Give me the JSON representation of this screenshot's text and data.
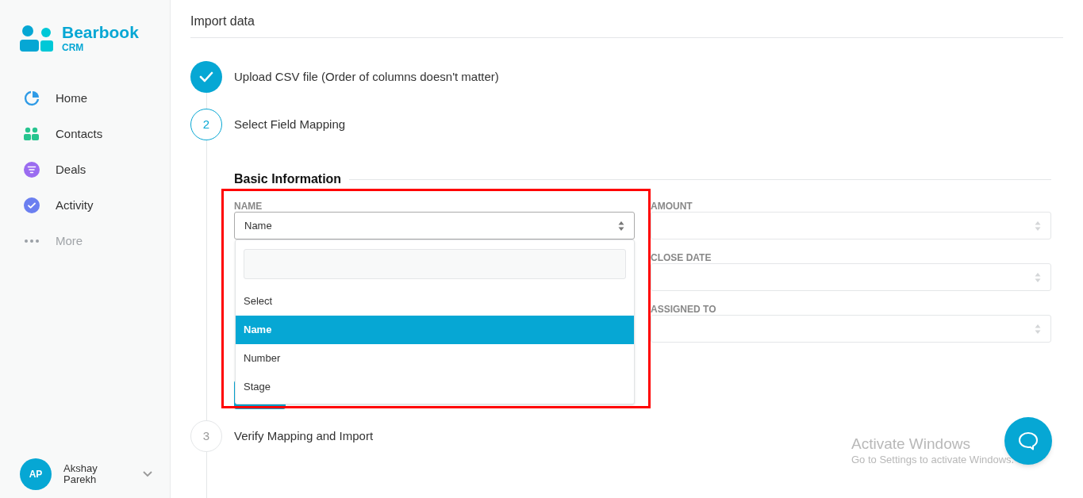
{
  "brand": {
    "name": "Bearbook",
    "sub": "CRM"
  },
  "nav": [
    {
      "label": "Home",
      "disabled": false
    },
    {
      "label": "Contacts",
      "disabled": false
    },
    {
      "label": "Deals",
      "disabled": false
    },
    {
      "label": "Activity",
      "disabled": false
    },
    {
      "label": "More",
      "disabled": true
    }
  ],
  "user": {
    "initials": "AP",
    "name": "Akshay Parekh"
  },
  "page_title": "Import data",
  "steps": [
    {
      "completed": true,
      "label": "Upload CSV file (Order of columns doesn't matter)"
    },
    {
      "completed": false,
      "active": true,
      "number": "2",
      "label": "Select Field Mapping"
    },
    {
      "completed": false,
      "active": false,
      "number": "3",
      "label": "Verify Mapping and Import"
    }
  ],
  "section": {
    "title": "Basic Information",
    "left_fields": [
      {
        "label": "NAME",
        "value": "Name"
      }
    ],
    "right_fields": [
      {
        "label": "AMOUNT"
      },
      {
        "label": "CLOSE DATE"
      },
      {
        "label": "ASSIGNED TO"
      }
    ]
  },
  "dropdown": {
    "options": [
      {
        "label": "Select",
        "selected": false
      },
      {
        "label": "Name",
        "selected": true
      },
      {
        "label": "Number",
        "selected": false
      },
      {
        "label": "Stage",
        "selected": false
      }
    ]
  },
  "watermark": {
    "title": "Activate Windows",
    "text": "Go to Settings to activate Windows."
  }
}
